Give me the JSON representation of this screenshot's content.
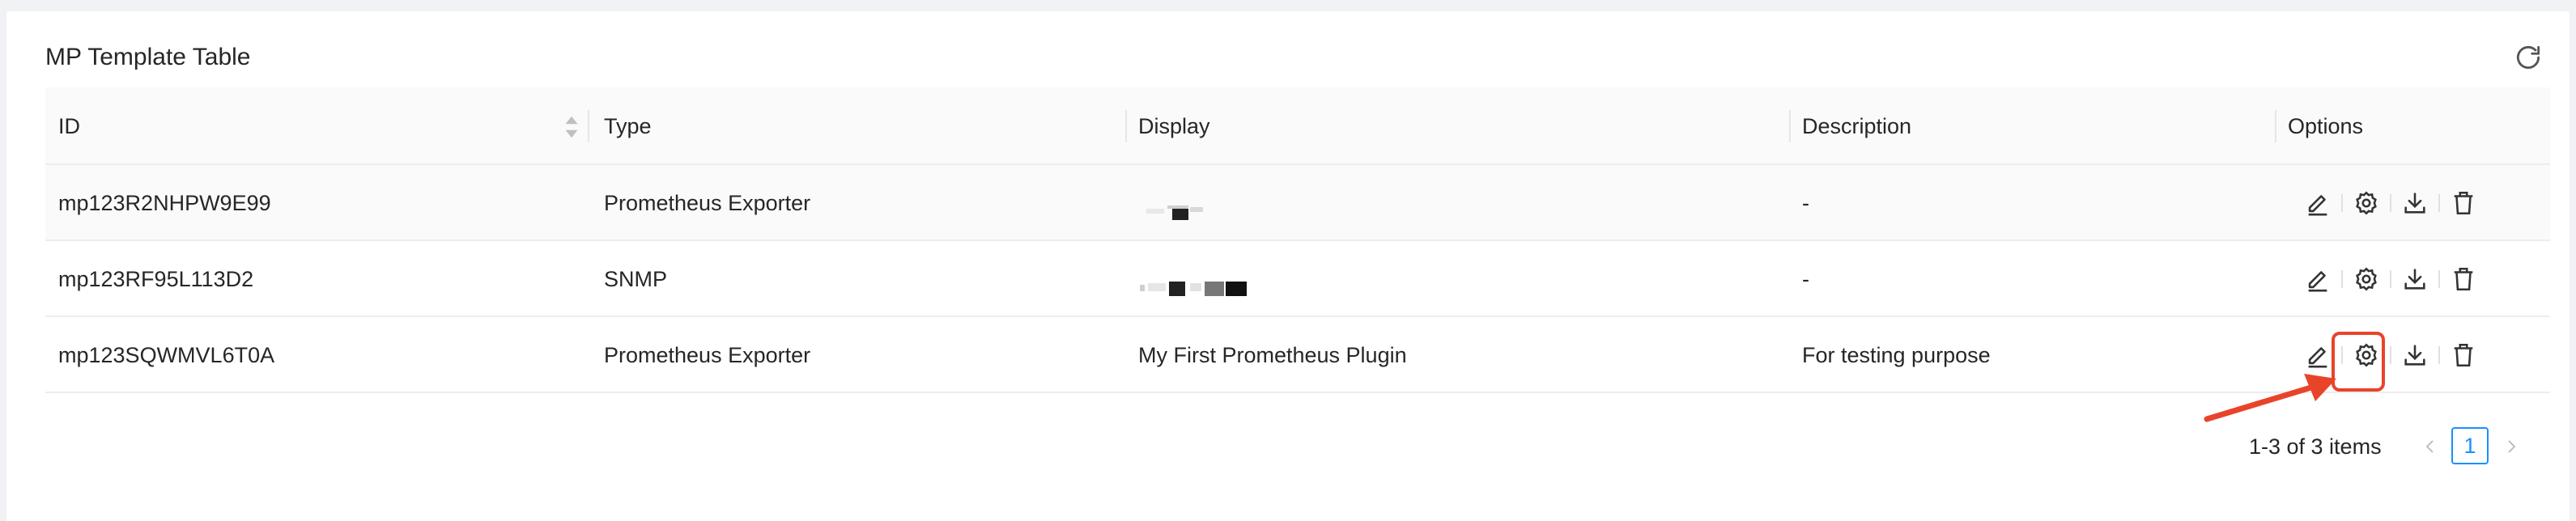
{
  "card": {
    "title": "MP Template Table"
  },
  "table": {
    "columns": [
      "ID",
      "Type",
      "Display",
      "Description",
      "Options"
    ],
    "rows": [
      {
        "id": "mp123R2NHPW9E99",
        "type": "Prometheus Exporter",
        "display": "",
        "description": "-"
      },
      {
        "id": "mp123RF95L113D2",
        "type": "SNMP",
        "display": "",
        "description": "-"
      },
      {
        "id": "mp123SQWMVL6T0A",
        "type": "Prometheus Exporter",
        "display": "My First Prometheus Plugin",
        "description": "For testing purpose"
      }
    ]
  },
  "pagination": {
    "total_text": "1-3 of 3 items",
    "current_page": "1"
  },
  "icons": [
    "reload-icon",
    "sort-icon",
    "edit-icon",
    "settings-icon",
    "download-icon",
    "delete-icon",
    "chevron-left-icon",
    "chevron-right-icon"
  ],
  "colors": {
    "accent": "#1890ff",
    "annotation": "#e8442a"
  }
}
